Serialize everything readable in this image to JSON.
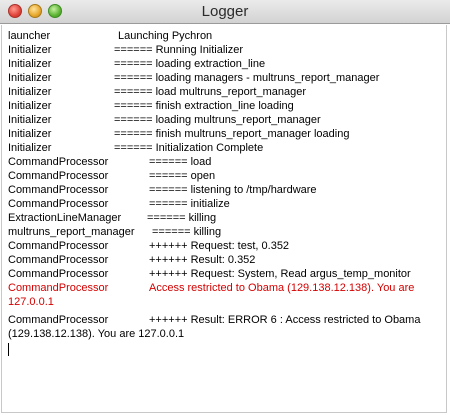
{
  "window": {
    "title": "Logger"
  },
  "log": {
    "entries": [
      {
        "source": "launcher",
        "message": "Launching Pychron"
      },
      {
        "source": "Initializer",
        "message": "====== Running Initializer"
      },
      {
        "source": "Initializer",
        "message": "====== loading extraction_line"
      },
      {
        "source": "Initializer",
        "message": "====== loading managers - multruns_report_manager"
      },
      {
        "source": "Initializer",
        "message": "====== load multruns_report_manager"
      },
      {
        "source": "Initializer",
        "message": "====== finish extraction_line loading"
      },
      {
        "source": "Initializer",
        "message": "====== loading multruns_report_manager"
      },
      {
        "source": "Initializer",
        "message": "====== finish multruns_report_manager loading"
      },
      {
        "source": "Initializer",
        "message": "====== Initialization Complete"
      },
      {
        "source": "CommandProcessor",
        "message": "====== load"
      },
      {
        "source": "CommandProcessor",
        "message": "====== open"
      },
      {
        "source": "CommandProcessor",
        "message": "====== listening to /tmp/hardware"
      },
      {
        "source": "CommandProcessor",
        "message": "====== initialize"
      },
      {
        "source": "ExtractionLineManager",
        "message": "====== killing"
      },
      {
        "source": "multruns_report_manager",
        "message": "====== killing"
      },
      {
        "source": "CommandProcessor",
        "message": "++++++ Request: test, 0.352"
      },
      {
        "source": "CommandProcessor",
        "message": "++++++ Result: 0.352"
      },
      {
        "source": "CommandProcessor",
        "message": "++++++ Request: System, Read argus_temp_monitor"
      },
      {
        "source": "CommandProcessor",
        "message": "Access restricted to Obama (129.138.12.138). You are 127.0.0.1"
      },
      {
        "source": "CommandProcessor",
        "message": "++++++ Result: ERROR 6 : Access restricted to Obama (129.138.12.138). You are 127.0.0.1"
      }
    ]
  },
  "colors": {
    "error_text": "#d40000"
  }
}
